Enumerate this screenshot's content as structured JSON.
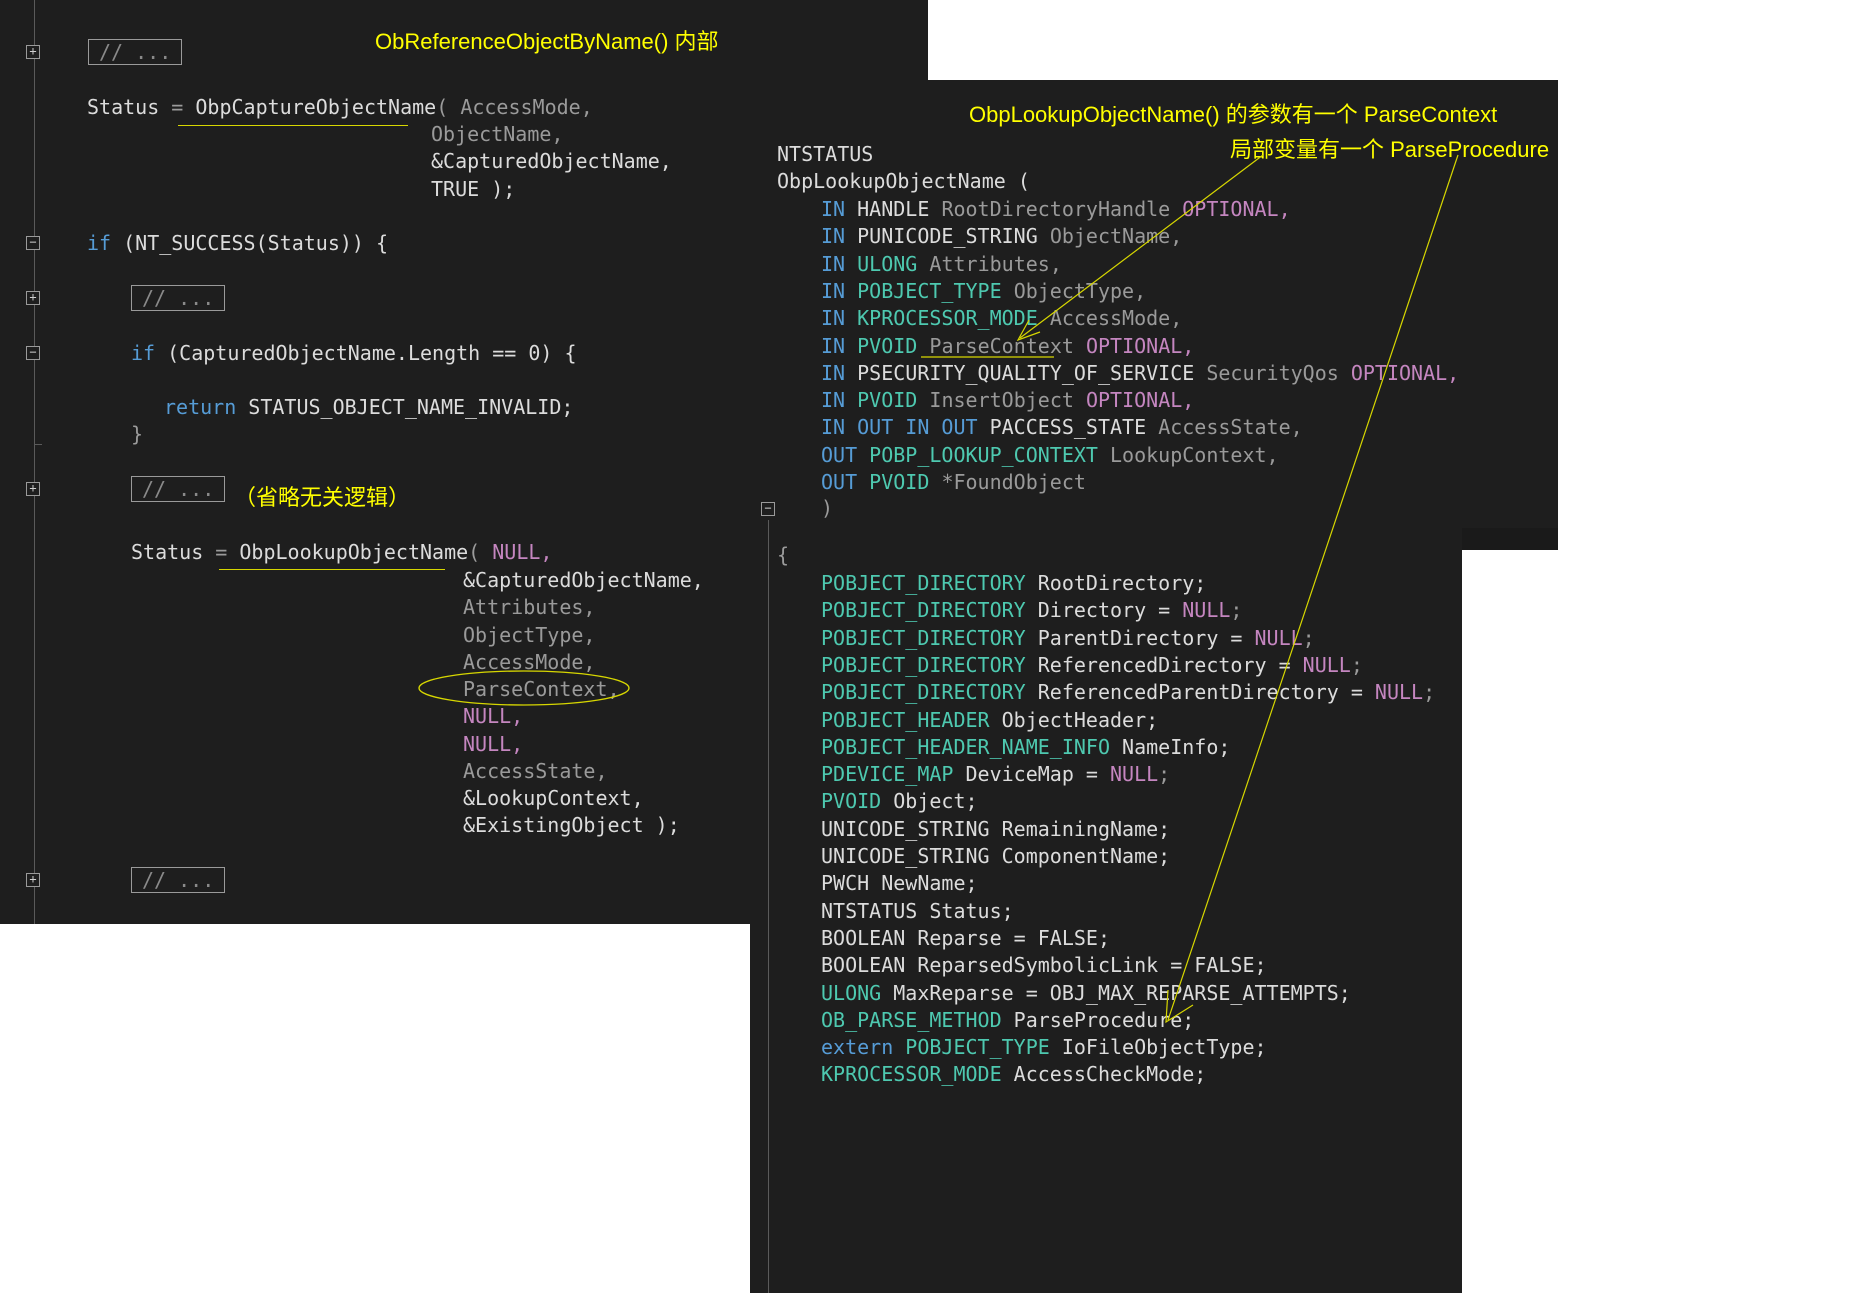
{
  "colors": {
    "background": "#1e1e1e",
    "keyword": "#569cd6",
    "type": "#4ec9b0",
    "macro": "#c586c0",
    "annotation": "#ffff00"
  },
  "left": {
    "annotation_title": "ObReferenceObjectByName() 内部",
    "annotation_omit": "（省略无关逻辑）",
    "collapsed_label": "// ...",
    "line_status1_lhs": "Status",
    "eq": "=",
    "capture_fn": "ObpCaptureObjectName",
    "capture_paren": "(",
    "capture_args": [
      "AccessMode,",
      "ObjectName,",
      "&CapturedObjectName,",
      "TRUE );"
    ],
    "if_kw": "if",
    "if_cond": "(NT_SUCCESS(Status)) {",
    "if2_kw": "if",
    "if2_cond": "(CapturedObjectName.Length == 0) {",
    "return_kw": "return",
    "return_val": "STATUS_OBJECT_NAME_INVALID;",
    "close_brace": "}",
    "line_status2_lhs": "Status",
    "lookup_fn": "ObpLookupObjectName",
    "lookup_paren": "(",
    "lookup_args": [
      "NULL,",
      "&CapturedObjectName,",
      "Attributes,",
      "ObjectType,",
      "AccessMode,",
      "ParseContext,",
      "NULL,",
      "NULL,",
      "AccessState,",
      "&LookupContext,",
      "&ExistingObject );"
    ]
  },
  "right": {
    "annotation_line1": "ObpLookupObjectName() 的参数有一个 ParseContext",
    "annotation_line2": "局部变量有一个 ParseProcedure",
    "ret_type": "NTSTATUS",
    "fn_name": "ObpLookupObjectName (",
    "params": [
      {
        "dir": "IN",
        "type": "HANDLE",
        "name": "RootDirectoryHandle",
        "opt": "OPTIONAL,",
        "sep": ""
      },
      {
        "dir": "IN",
        "type": "PUNICODE_STRING",
        "name": "ObjectName,",
        "opt": "",
        "sep": ""
      },
      {
        "dir": "IN",
        "type": "ULONG",
        "name": "Attributes,",
        "opt": "",
        "sep": ""
      },
      {
        "dir": "IN",
        "type": "POBJECT_TYPE",
        "name": "ObjectType,",
        "opt": "",
        "sep": ""
      },
      {
        "dir": "IN",
        "type": "KPROCESSOR_MODE",
        "name": "AccessMode,",
        "opt": "",
        "sep": ""
      },
      {
        "dir": "IN",
        "type": "PVOID",
        "name": "ParseContext",
        "opt": "OPTIONAL,",
        "sep": ""
      },
      {
        "dir": "IN",
        "type": "PSECURITY_QUALITY_OF_SERVICE",
        "name": "SecurityQos",
        "opt": "OPTIONAL,",
        "sep": ""
      },
      {
        "dir": "IN",
        "type": "PVOID",
        "name": "InsertObject",
        "opt": "OPTIONAL,",
        "sep": ""
      },
      {
        "dir": "IN OUT",
        "type": "PACCESS_STATE",
        "name": "AccessState,",
        "opt": "",
        "sep": ""
      },
      {
        "dir": "OUT",
        "type": "POBP_LOOKUP_CONTEXT",
        "name": "LookupContext,",
        "opt": "",
        "sep": ""
      },
      {
        "dir": "OUT",
        "type": "PVOID",
        "name": "*FoundObject",
        "opt": "",
        "sep": ""
      }
    ],
    "close_paren": ")",
    "open_brace": "{",
    "locals": [
      {
        "type": "POBJECT_DIRECTORY",
        "name": "RootDirectory;",
        "init": ""
      },
      {
        "type": "POBJECT_DIRECTORY",
        "name": "Directory =",
        "init": "NULL",
        "end": ";"
      },
      {
        "type": "POBJECT_DIRECTORY",
        "name": "ParentDirectory =",
        "init": "NULL",
        "end": ";"
      },
      {
        "type": "POBJECT_DIRECTORY",
        "name": "ReferencedDirectory =",
        "init": "NULL",
        "end": ";"
      },
      {
        "type": "POBJECT_DIRECTORY",
        "name": "ReferencedParentDirectory =",
        "init": "NULL",
        "end": ";"
      },
      {
        "type": "POBJECT_HEADER",
        "name": "ObjectHeader;",
        "init": ""
      },
      {
        "type": "POBJECT_HEADER_NAME_INFO",
        "name": "NameInfo;",
        "init": ""
      },
      {
        "type": "PDEVICE_MAP",
        "name": "DeviceMap =",
        "init": "NULL",
        "end": ";"
      },
      {
        "type": "PVOID",
        "name": "Object;",
        "init": ""
      },
      {
        "type": "UNICODE_STRING",
        "name": "RemainingName;",
        "init": "",
        "plain": true
      },
      {
        "type": "UNICODE_STRING",
        "name": "ComponentName;",
        "init": "",
        "plain": true
      },
      {
        "type": "PWCH",
        "name": "NewName;",
        "init": "",
        "plain": true
      },
      {
        "type": "NTSTATUS",
        "name": "Status;",
        "init": "",
        "plain": true
      },
      {
        "type": "BOOLEAN",
        "name": "Reparse = FALSE;",
        "init": "",
        "plain": true
      },
      {
        "type": "BOOLEAN",
        "name": "ReparsedSymbolicLink = FALSE;",
        "init": "",
        "plain": true
      },
      {
        "type": "ULONG",
        "name": "MaxReparse = OBJ_MAX_REPARSE_ATTEMPTS;",
        "init": ""
      },
      {
        "type": "OB_PARSE_METHOD",
        "name": "ParseProcedure;",
        "init": ""
      },
      {
        "type": "extern POBJECT_TYPE",
        "name": "IoFileObjectType;",
        "init": ""
      },
      {
        "type": "KPROCESSOR_MODE",
        "name": "AccessCheckMode;",
        "init": ""
      }
    ]
  }
}
